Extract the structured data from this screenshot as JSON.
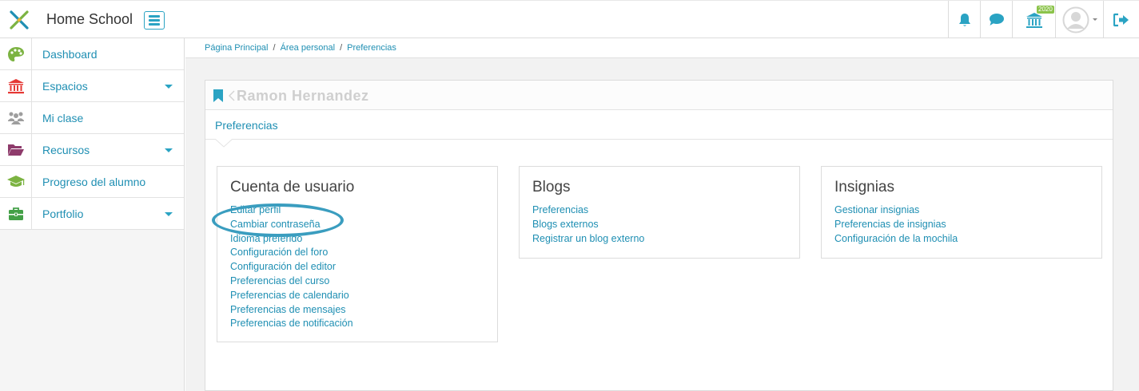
{
  "header": {
    "site_name": "Home School",
    "menu_icon": "hamburger-icon",
    "notifications_icon": "bell-icon",
    "messages_icon": "chat-bubble-icon",
    "course_icon": "institution-icon",
    "course_badge": "2020",
    "user_menu_icon": "user-avatar-icon",
    "logout_icon": "sign-out-icon",
    "accent_color": "#2aa3c3"
  },
  "sidebar": {
    "items": [
      {
        "label": "Dashboard",
        "icon": "palette-dashboard-icon",
        "color": "#7cb342",
        "has_submenu": false
      },
      {
        "label": "Espacios",
        "icon": "institution-icon",
        "color": "#e53935",
        "has_submenu": true
      },
      {
        "label": "Mi clase",
        "icon": "group-icon",
        "color": "#9e9e9e",
        "has_submenu": false
      },
      {
        "label": "Recursos",
        "icon": "folder-open-icon",
        "color": "#8e3b6b",
        "has_submenu": true
      },
      {
        "label": "Progreso del alumno",
        "icon": "graduation-cap-icon",
        "color": "#7cb342",
        "has_submenu": false
      },
      {
        "label": "Portfolio",
        "icon": "briefcase-icon",
        "color": "#43a047",
        "has_submenu": true
      }
    ]
  },
  "breadcrumb": {
    "items": [
      "Página Principal",
      "Área personal",
      "Preferencias"
    ],
    "separator": "/"
  },
  "page": {
    "user_name": "Ramon Hernandez",
    "tab": "Preferencias"
  },
  "sections": [
    {
      "title": "Cuenta de usuario",
      "links": [
        "Editar perfil",
        "Cambiar contraseña",
        "Idioma preferido",
        "Configuración del foro",
        "Configuración del editor",
        "Preferencias del curso",
        "Preferencias de calendario",
        "Preferencias de mensajes",
        "Preferencias de notificación"
      ]
    },
    {
      "title": "Blogs",
      "links": [
        "Preferencias",
        "Blogs externos",
        "Registrar un blog externo"
      ]
    },
    {
      "title": "Insignias",
      "links": [
        "Gestionar insignias",
        "Preferencias de insignias",
        "Configuración de la mochila"
      ]
    }
  ]
}
